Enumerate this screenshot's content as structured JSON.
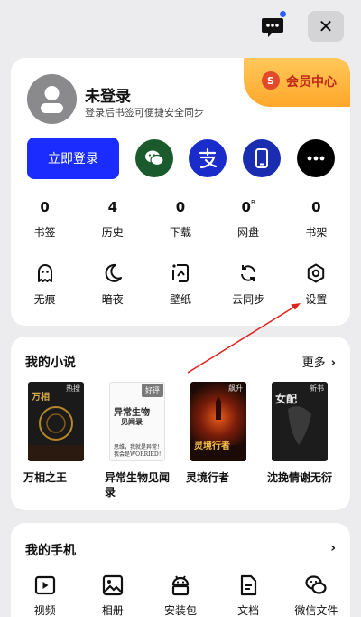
{
  "header": {
    "message_icon": "chat-bubble-icon",
    "close_label": "✕"
  },
  "account": {
    "title": "未登录",
    "subtitle": "登录后书签可便捷安全同步",
    "login_button": "立即登录",
    "vip_badge": "S",
    "vip_label": "会员中心",
    "sso": [
      "wechat-icon",
      "alipay-icon",
      "phone-icon",
      "more-icon"
    ]
  },
  "stats": [
    {
      "num": "0",
      "unit": "",
      "label": "书签"
    },
    {
      "num": "4",
      "unit": "",
      "label": "历史"
    },
    {
      "num": "0",
      "unit": "",
      "label": "下载"
    },
    {
      "num": "0",
      "unit": "B",
      "label": "网盘"
    },
    {
      "num": "0",
      "unit": "",
      "label": "书架"
    }
  ],
  "tools": [
    {
      "label": "无痕",
      "icon": "ghost-icon"
    },
    {
      "label": "暗夜",
      "icon": "moon-icon"
    },
    {
      "label": "壁纸",
      "icon": "wallpaper-icon"
    },
    {
      "label": "云同步",
      "icon": "sync-icon"
    },
    {
      "label": "设置",
      "icon": "settings-icon"
    }
  ],
  "novels": {
    "title": "我的小说",
    "more": "更多",
    "books": [
      {
        "title": "万相之王",
        "cover_tag": "热搜",
        "cover_text": "万相"
      },
      {
        "title": "异常生物见闻录",
        "cover_tag": "好评",
        "cover_text": "异常生物",
        "cover_sub": "见闻录",
        "cover_line": "思维，我就是异常！",
        "cover_line2": "我会是WORRIED！"
      },
      {
        "title": "灵境行者",
        "cover_tag": "飙升",
        "cover_text": "灵境行者"
      },
      {
        "title": "沈挽情谢无衍",
        "cover_tag": "新书",
        "cover_text": "女配"
      }
    ]
  },
  "phone": {
    "title": "我的手机",
    "items": [
      {
        "label": "视频",
        "icon": "video-icon"
      },
      {
        "label": "相册",
        "icon": "album-icon"
      },
      {
        "label": "安装包",
        "icon": "android-icon"
      },
      {
        "label": "文档",
        "icon": "document-icon"
      },
      {
        "label": "微信文件",
        "icon": "wechat-file-icon"
      }
    ]
  }
}
